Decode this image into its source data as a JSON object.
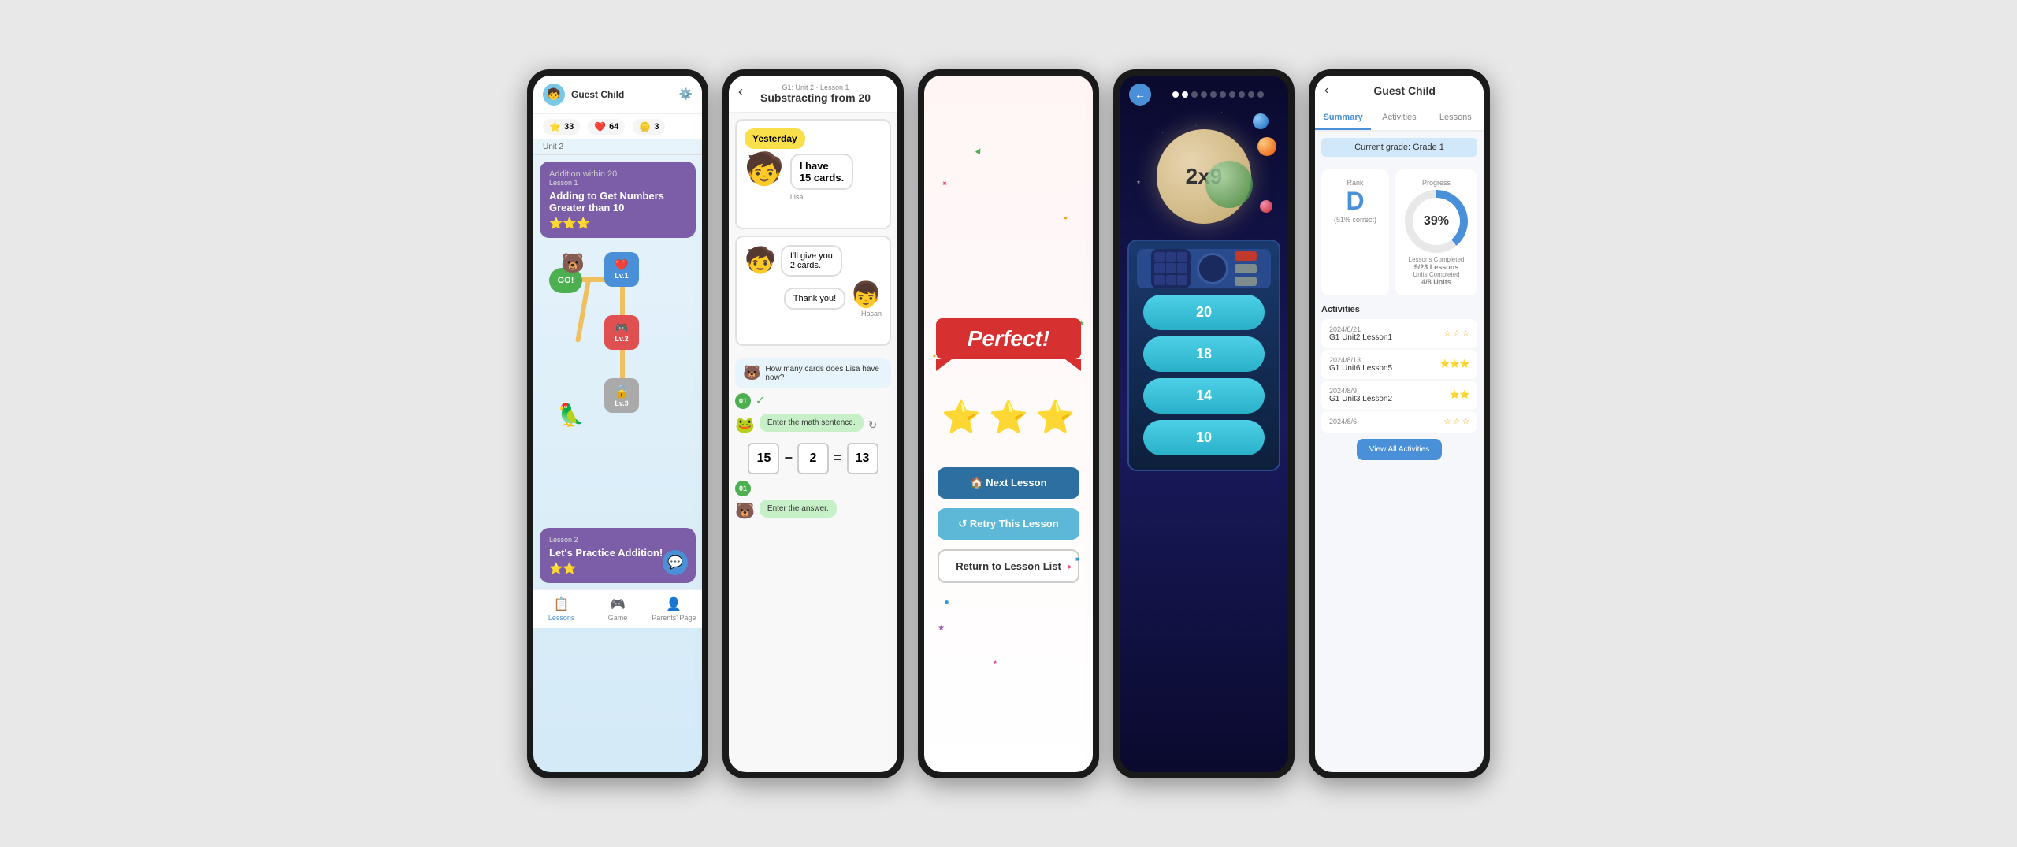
{
  "phones": [
    {
      "id": "phone1",
      "type": "lessons-map",
      "header": {
        "username": "Guest Child",
        "avatar_emoji": "🧒"
      },
      "stats": [
        {
          "icon": "⭐",
          "value": "33",
          "color": "#f5a623"
        },
        {
          "icon": "❤️",
          "value": "64",
          "color": "#e74c7c"
        },
        {
          "icon": "🪙",
          "value": "3",
          "color": "#f5a623"
        }
      ],
      "unit_label": "Unit 2",
      "current_lesson": {
        "unit_label": "Addition within 20",
        "lesson_number": "Lesson 1",
        "lesson_name": "Adding to Get Numbers Greater than 10",
        "stars": "⭐⭐⭐"
      },
      "nodes": [
        {
          "label": "GO!",
          "type": "go"
        },
        {
          "label": "Lv.1",
          "type": "lv1"
        },
        {
          "label": "Lv.2",
          "type": "lv2"
        },
        {
          "label": "Lv.3",
          "type": "lv3",
          "locked": true
        }
      ],
      "lesson2": {
        "name": "Let's Practice Addition!",
        "stars": "⭐⭐"
      },
      "nav": [
        {
          "label": "Lessons",
          "icon": "📋",
          "active": true
        },
        {
          "label": "Game",
          "icon": "🎮",
          "active": false
        },
        {
          "label": "Parents' Page",
          "icon": "👤",
          "active": false
        }
      ]
    },
    {
      "id": "phone2",
      "type": "lesson-content",
      "header": {
        "back_icon": "‹",
        "subtitle": "G1: Unit 2 · Lesson 1",
        "title": "Substracting from 20"
      },
      "comic1": {
        "panel_label": "Yesterday",
        "character": "Lisa",
        "speech": "I have\n15 cards."
      },
      "comic2": {
        "speaker1_speech": "I'll give you\n2 cards.",
        "speaker2_speech": "Thank you!",
        "character": "Hasan"
      },
      "question": {
        "text": "How many cards does Lisa have now?",
        "mascot": "🐻"
      },
      "answer_indicator": "01",
      "answer_text": "Enter the math sentence.",
      "math_equation": {
        "num1": "15",
        "operator": "−",
        "num2": "2",
        "equals": "=",
        "result": "13"
      },
      "answer_indicator2": "01",
      "prompt2": "Enter the answer."
    },
    {
      "id": "phone3",
      "type": "perfect-screen",
      "banner_text": "Perfect!",
      "stars": [
        "⭐",
        "⭐",
        "⭐"
      ],
      "buttons": [
        {
          "label": "🏠 Next Lesson",
          "type": "next"
        },
        {
          "label": "↺ Retry This Lesson",
          "type": "retry"
        },
        {
          "label": "Return to Lesson List",
          "type": "return"
        }
      ]
    },
    {
      "id": "phone4",
      "type": "space-game",
      "problem": "2x9",
      "answers": [
        "20",
        "18",
        "14",
        "10"
      ],
      "progress_dots": 10,
      "active_dot": 2
    },
    {
      "id": "phone5",
      "type": "progress-report",
      "header": {
        "back_icon": "‹",
        "name": "Guest Child"
      },
      "tabs": [
        "Summary",
        "Activities",
        "Lessons"
      ],
      "active_tab": 0,
      "grade_label": "Current grade: Grade 1",
      "rank": {
        "label": "Rank",
        "grade": "D",
        "percentile": "(51% correct)"
      },
      "progress": {
        "label": "Progress",
        "percentage": "39%",
        "lessons_completed": "9/23 Lessons",
        "units_completed": "4/8 Units"
      },
      "activities_title": "Activities",
      "activities": [
        {
          "date": "2024/8/21",
          "name": "G1 Unit2 Lesson1",
          "stars": ""
        },
        {
          "date": "2024/8/13",
          "name": "G1 Unit6 Lesson5",
          "stars": "⭐⭐⭐"
        },
        {
          "date": "2024/8/9",
          "name": "G1 Unit3 Lesson2",
          "stars": "⭐⭐"
        },
        {
          "date": "2024/8/6",
          "name": "",
          "stars": ""
        }
      ],
      "view_all_btn": "View All Activities"
    }
  ]
}
